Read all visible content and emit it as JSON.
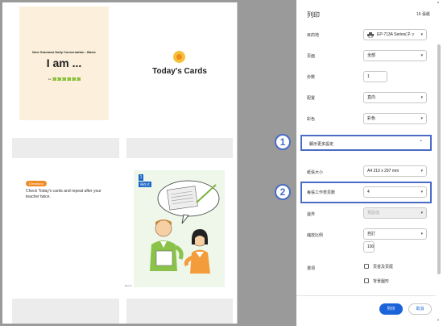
{
  "preview": {
    "card1": {
      "series": "New Grammar Daily Conversation - Basic",
      "title": "I am ...",
      "code_prefix": "Lv.",
      "code_blocks": [
        "1",
        "1",
        "1",
        "1",
        "1",
        "1"
      ]
    },
    "card2": {
      "title": "Today's Cards",
      "icon": "sun-icon"
    },
    "card3": {
      "badge": "Directions",
      "instruction": "Check Today's cards and repeat after your teacher twice."
    },
    "card4": {
      "number": "1",
      "tense": "現在式",
      "credit": "Ern.co"
    }
  },
  "panel": {
    "title": "列印",
    "sheets": "16 張紙",
    "destination": {
      "label": "目的地",
      "value": "EP-713A Series(ネッ",
      "icon": "printer-icon"
    },
    "pages": {
      "label": "頁面",
      "value": "全部"
    },
    "copies": {
      "label": "份數",
      "value": "1"
    },
    "layout": {
      "label": "配置",
      "value": "直向"
    },
    "color": {
      "label": "彩色",
      "value": "彩色"
    },
    "more_settings": {
      "label": "顯示更多設定"
    },
    "paper_size": {
      "label": "紙張大小",
      "value": "A4 210 x 297 mm"
    },
    "pages_per_sheet": {
      "label": "每張工作表頁數",
      "value": "4"
    },
    "margins": {
      "label": "邊界",
      "value": "預設值"
    },
    "scale": {
      "label": "縮放比例",
      "value": "自訂",
      "input": "100"
    },
    "options": {
      "label": "選項",
      "headers_footers": "頁首及頁尾",
      "background_graphics": "背景圖形"
    },
    "print_button": "列印",
    "cancel_button": "取消"
  },
  "callouts": [
    "1",
    "2"
  ],
  "colors": {
    "accent": "#1b63d8",
    "callout": "#4a6cc6",
    "card1_bg": "#fcf0dc",
    "orange": "#f08a24"
  }
}
